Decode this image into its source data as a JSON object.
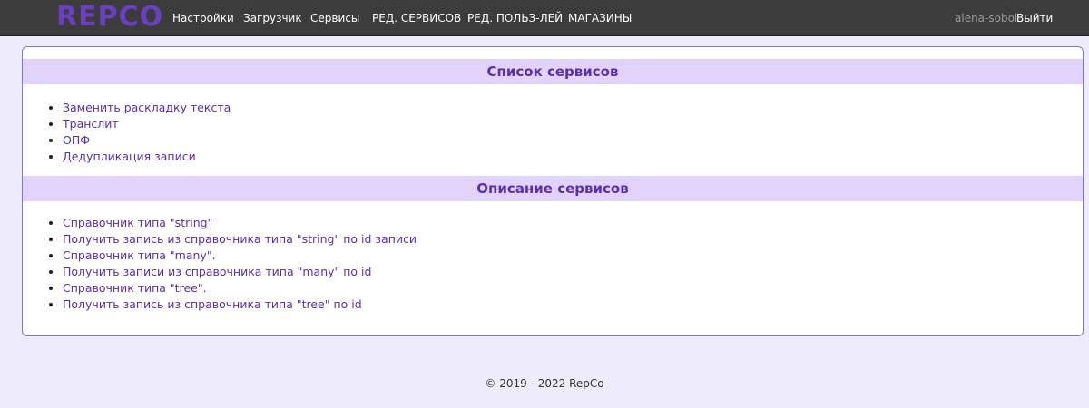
{
  "navbar": {
    "brand": "REPCO",
    "links": [
      "Настройки",
      "Загрузчик",
      "Сервисы",
      "РЕД. СЕРВИСОВ",
      "РЕД. ПОЛЬЗ-ЛЕЙ",
      "МАГАЗИНЫ"
    ],
    "username": "alena-sobol",
    "logout_label": "Выйти"
  },
  "services": {
    "title": "Список сервисов",
    "items": [
      "Заменить раскладку текста",
      "Транслит",
      "ОПФ",
      "Дедупликация записи"
    ]
  },
  "descriptions": {
    "title": "Описание сервисов",
    "items": [
      "Справочник типа \"string\"",
      "Получить запись из справочника типа \"string\" по id записи",
      "Справочник типа \"many\".",
      "Получить записи из справочника типа \"many\" по id",
      "Справочник типа \"tree\".",
      "Получить запись из справочника типа \"tree\" по id"
    ]
  },
  "footer": {
    "text": "© 2019 - 2022 RepCo"
  }
}
